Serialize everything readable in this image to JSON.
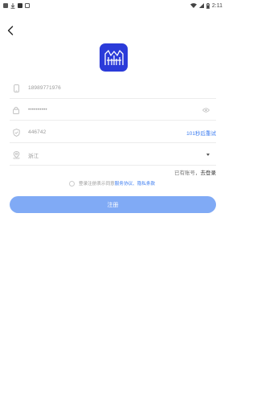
{
  "status_bar": {
    "time": "2:11"
  },
  "form": {
    "phone": "18989771976",
    "password": "••••••••••",
    "code": "446742",
    "resend_label": "101秒后重试",
    "region": "浙江"
  },
  "login_prompt": {
    "text": "已有账号，",
    "link": "去登录"
  },
  "agreement": {
    "prefix": "登录注册表示同意",
    "terms": "服务协议",
    "separator": "、",
    "privacy": "隐私条款"
  },
  "register_button": {
    "label": "注册"
  },
  "colors": {
    "accent": "#3b7cf0",
    "button": "#80aaf5",
    "logo_bg": "#2b3bd9"
  },
  "icons": {
    "back": "chevron-left-icon",
    "phone": "phone-icon",
    "lock": "lock-icon",
    "eye": "eye-icon",
    "shield": "shield-icon",
    "location": "location-icon",
    "dropdown": "caret-down-icon"
  }
}
